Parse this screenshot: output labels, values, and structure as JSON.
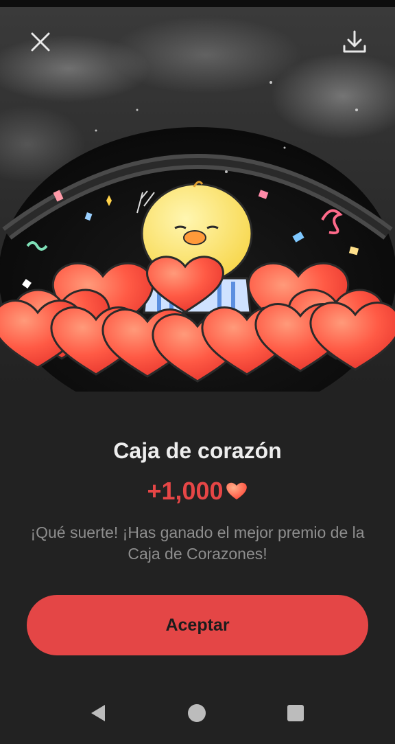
{
  "header": {
    "close_icon": "close-icon",
    "download_icon": "download-icon"
  },
  "reward": {
    "title": "Caja de corazón",
    "amount": "+1,000",
    "currency_icon": "heart-icon",
    "message": "¡Qué suerte! ¡Has ganado el mejor premio de la Caja de Corazones!"
  },
  "actions": {
    "accept_label": "Aceptar"
  },
  "nav": {
    "back_icon": "back-triangle-icon",
    "home_icon": "home-circle-icon",
    "recents_icon": "recents-square-icon"
  },
  "colors": {
    "background": "#222222",
    "accent": "#e44646",
    "heart": "#ff6a4a"
  }
}
